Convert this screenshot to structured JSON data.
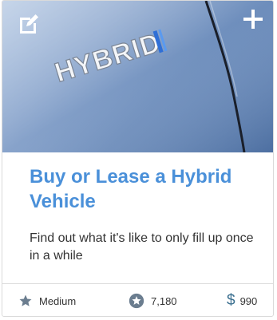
{
  "card": {
    "image": {
      "badge_text": "HYBRID",
      "subject": "car-badge-photo"
    },
    "title": "Buy or Lease a Hybrid Vehicle",
    "description": "Find out what it's like to only fill up once in a while",
    "footer": {
      "difficulty": "Medium",
      "points": "7,180",
      "cost_symbol": "$",
      "cost": "990"
    }
  },
  "icons": {
    "edit": "edit-icon",
    "add": "plus-icon",
    "difficulty": "star-icon",
    "points": "star-badge-icon"
  },
  "colors": {
    "title": "#4a90d9",
    "text": "#333333",
    "icon_gray": "#6b7d8f",
    "border": "#dadada"
  }
}
